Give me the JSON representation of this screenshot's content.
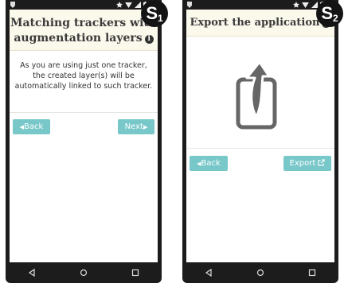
{
  "screens": [
    {
      "badge_letter": "S",
      "badge_number": "1",
      "title_line1": "Matching trackers with",
      "title_line2": "augmentation layers",
      "body": "As you are using just one tracker, the created layer(s) will be automatically linked to such tracker.",
      "back_label": "Back",
      "next_label": "Next"
    },
    {
      "badge_letter": "S",
      "badge_number": "2",
      "title": "Export the application",
      "back_label": "Back",
      "export_label": "Export"
    }
  ],
  "colors": {
    "button": "#78c7c9",
    "title_bg": "#fbf8ec"
  },
  "icons": [
    "info-icon",
    "export-app-icon",
    "back-nav-icon",
    "home-nav-icon",
    "recents-nav-icon"
  ]
}
